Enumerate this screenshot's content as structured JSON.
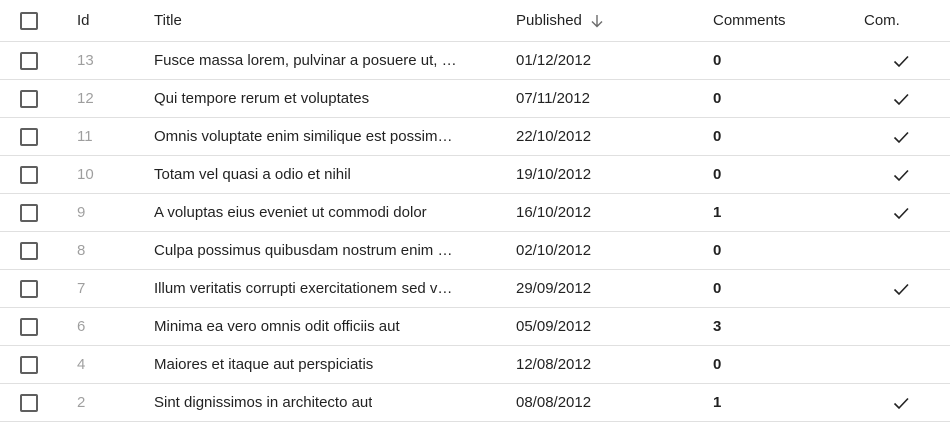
{
  "header": {
    "id": "Id",
    "title": "Title",
    "published": "Published",
    "comments": "Comments",
    "commentable": "Com."
  },
  "rows": [
    {
      "id": "13",
      "title": "Fusce massa lorem, pulvinar a posuere ut, …",
      "published": "01/12/2012",
      "comments": "0",
      "commentable": true
    },
    {
      "id": "12",
      "title": "Qui tempore rerum et voluptates",
      "published": "07/11/2012",
      "comments": "0",
      "commentable": true
    },
    {
      "id": "11",
      "title": "Omnis voluptate enim similique est possim…",
      "published": "22/10/2012",
      "comments": "0",
      "commentable": true
    },
    {
      "id": "10",
      "title": "Totam vel quasi a odio et nihil",
      "published": "19/10/2012",
      "comments": "0",
      "commentable": true
    },
    {
      "id": "9",
      "title": "A voluptas eius eveniet ut commodi dolor",
      "published": "16/10/2012",
      "comments": "1",
      "commentable": true
    },
    {
      "id": "8",
      "title": "Culpa possimus quibusdam nostrum enim …",
      "published": "02/10/2012",
      "comments": "0",
      "commentable": false
    },
    {
      "id": "7",
      "title": "Illum veritatis corrupti exercitationem sed v…",
      "published": "29/09/2012",
      "comments": "0",
      "commentable": true
    },
    {
      "id": "6",
      "title": "Minima ea vero omnis odit officiis aut",
      "published": "05/09/2012",
      "comments": "3",
      "commentable": false
    },
    {
      "id": "4",
      "title": "Maiores et itaque aut perspiciatis",
      "published": "12/08/2012",
      "comments": "0",
      "commentable": false
    },
    {
      "id": "2",
      "title": "Sint dignissimos in architecto aut",
      "published": "08/08/2012",
      "comments": "1",
      "commentable": true
    }
  ],
  "icons": {
    "sort": "arrow-down-icon",
    "check": "check-icon"
  }
}
